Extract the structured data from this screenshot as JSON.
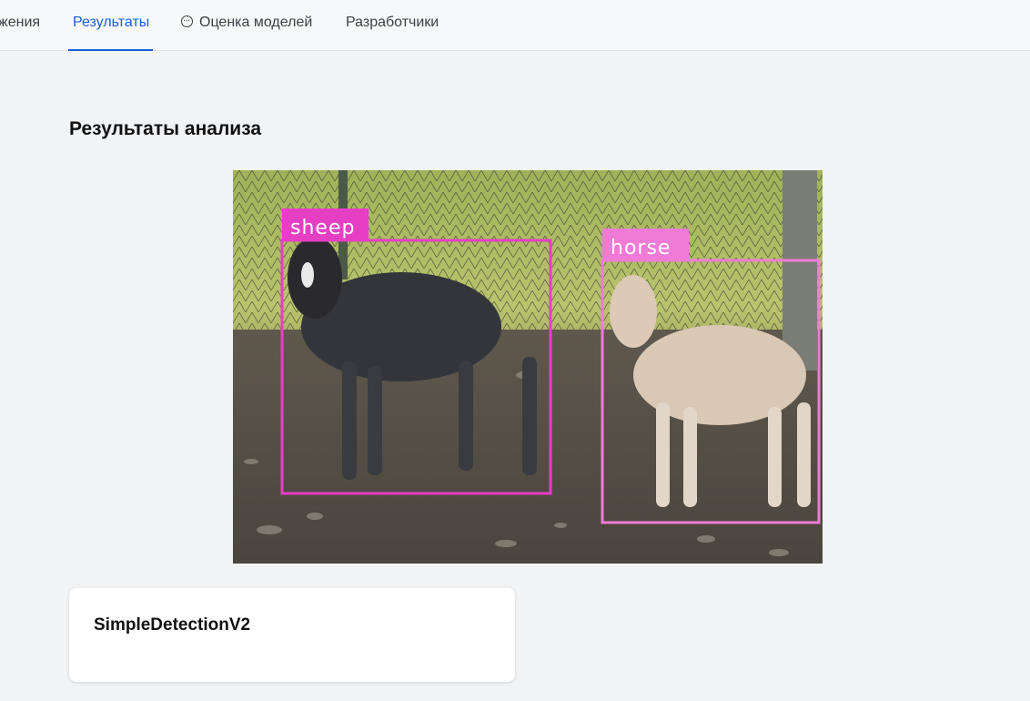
{
  "nav": {
    "tabs": [
      {
        "label": "жения",
        "active": false
      },
      {
        "label": "Результаты",
        "active": true
      },
      {
        "label": "Оценка моделей",
        "active": false,
        "icon": "chat-bubble-icon"
      },
      {
        "label": "Разработчики",
        "active": false
      }
    ]
  },
  "main": {
    "title": "Результаты анализа"
  },
  "detections": [
    {
      "label": "sheep",
      "color": "#e63fc4"
    },
    {
      "label": "horse",
      "color": "#f07bd6"
    }
  ],
  "card": {
    "title": "SimpleDetectionV2"
  },
  "colors": {
    "accent": "#1a5fd0",
    "background": "#f2f3f5"
  }
}
